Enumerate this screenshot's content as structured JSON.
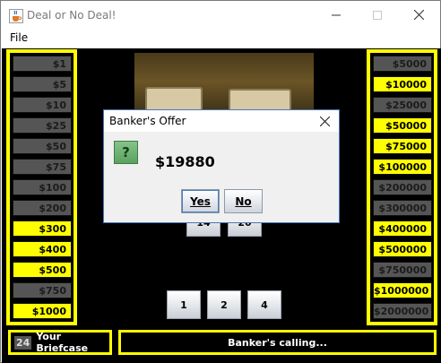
{
  "window": {
    "title": "Deal or No Deal!",
    "icon": "java-cup-icon"
  },
  "menu": {
    "file_label": "File"
  },
  "left_amounts": [
    {
      "label": "$1",
      "active": false
    },
    {
      "label": "$5",
      "active": false
    },
    {
      "label": "$10",
      "active": false
    },
    {
      "label": "$25",
      "active": false
    },
    {
      "label": "$50",
      "active": false
    },
    {
      "label": "$75",
      "active": false
    },
    {
      "label": "$100",
      "active": false
    },
    {
      "label": "$200",
      "active": false
    },
    {
      "label": "$300",
      "active": true
    },
    {
      "label": "$400",
      "active": true
    },
    {
      "label": "$500",
      "active": true
    },
    {
      "label": "$750",
      "active": false
    },
    {
      "label": "$1000",
      "active": true
    }
  ],
  "right_amounts": [
    {
      "label": "$5000",
      "active": false
    },
    {
      "label": "$10000",
      "active": true
    },
    {
      "label": "$25000",
      "active": false
    },
    {
      "label": "$50000",
      "active": true
    },
    {
      "label": "$75000",
      "active": true
    },
    {
      "label": "$100000",
      "active": true
    },
    {
      "label": "$200000",
      "active": false
    },
    {
      "label": "$300000",
      "active": false
    },
    {
      "label": "$400000",
      "active": true
    },
    {
      "label": "$500000",
      "active": true
    },
    {
      "label": "$750000",
      "active": false
    },
    {
      "label": "$1000000",
      "active": true
    },
    {
      "label": "$2000000",
      "active": false
    }
  ],
  "cases": {
    "upper": [
      "14",
      "20"
    ],
    "lower": [
      "1",
      "2",
      "4"
    ]
  },
  "briefcase": {
    "number": "24",
    "label": "Your Briefcase"
  },
  "status": {
    "text": "Banker's calling..."
  },
  "dialog": {
    "title": "Banker's Offer",
    "icon": "question-icon",
    "icon_glyph": "?",
    "offer": "$19880",
    "yes_label": "Yes",
    "no_label": "No"
  },
  "colors": {
    "accent": "#ffff00",
    "background": "#000000",
    "eliminated": "#555555"
  }
}
